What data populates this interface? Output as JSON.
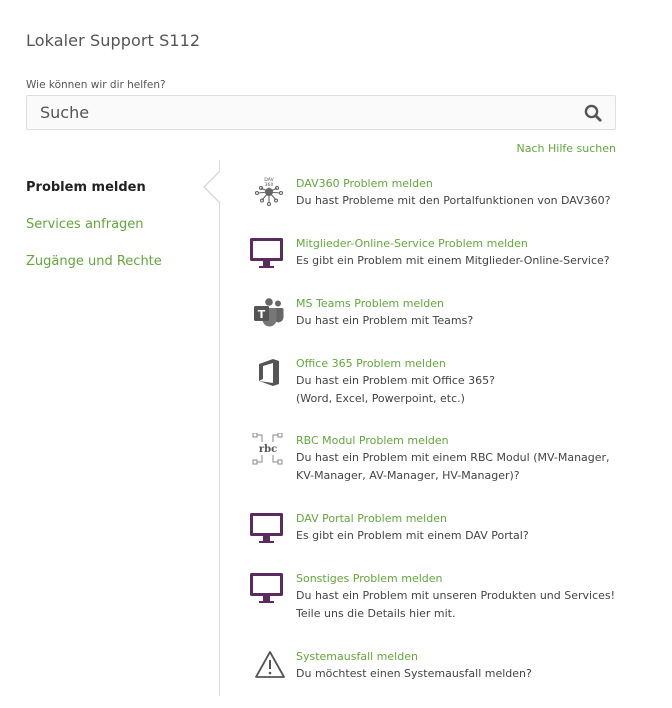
{
  "header": {
    "title": "Lokaler Support S112"
  },
  "search": {
    "label": "Wie können wir dir helfen?",
    "placeholder": "Suche",
    "help_link": "Nach Hilfe suchen"
  },
  "sidebar": {
    "items": [
      {
        "label": "Problem melden",
        "active": true
      },
      {
        "label": "Services anfragen",
        "active": false
      },
      {
        "label": "Zugänge und Rechte",
        "active": false
      }
    ]
  },
  "entries": [
    {
      "title": "DAV360 Problem melden",
      "desc": "Du hast Probleme mit den Portalfunktionen von DAV360?",
      "icon": "dav360-icon"
    },
    {
      "title": "Mitglieder-Online-Service Problem melden",
      "desc": "Es gibt ein Problem mit einem Mitglieder-Online-Service?",
      "icon": "monitor-icon"
    },
    {
      "title": "MS Teams Problem melden",
      "desc": "Du hast ein Problem mit Teams?",
      "icon": "teams-icon"
    },
    {
      "title": "Office 365 Problem melden",
      "desc": "Du hast ein Problem mit Office 365?\n(Word, Excel, Powerpoint, etc.)",
      "icon": "office-icon"
    },
    {
      "title": "RBC Modul Problem melden",
      "desc": "Du hast ein Problem mit einem RBC Modul (MV-Manager,\nKV-Manager, AV-Manager, HV-Manager)?",
      "icon": "rbc-icon"
    },
    {
      "title": "DAV Portal Problem melden",
      "desc": "Es gibt ein Problem mit einem DAV Portal?",
      "icon": "monitor-icon"
    },
    {
      "title": "Sonstiges Problem melden",
      "desc": "Du hast ein Problem mit unseren Produkten und Services!\nTeile uns die Details hier mit.",
      "icon": "monitor-icon"
    },
    {
      "title": "Systemausfall melden",
      "desc": "Du möchtest einen Systemausfall melden?",
      "icon": "warning-icon"
    }
  ],
  "colors": {
    "accent": "#62a73b",
    "monitor": "#5b2a5e"
  }
}
